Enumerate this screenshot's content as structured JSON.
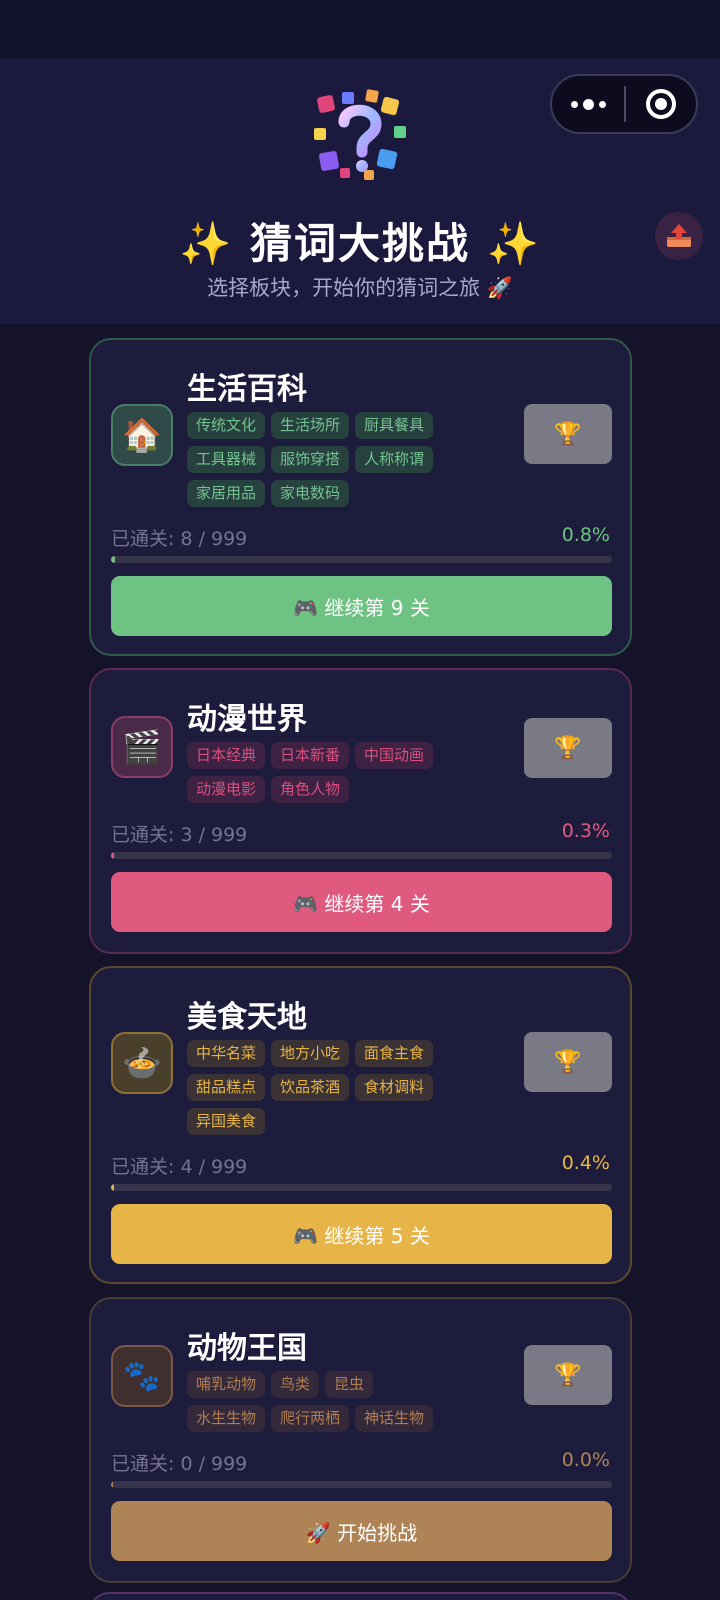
{
  "header": {
    "title": "✨ 猜词大挑战 ✨",
    "subtitle": "选择板块，开始你的猜词之旅 🚀",
    "logo_icon": "question-mark-icon",
    "share_icon": "upload-icon"
  },
  "cards": [
    {
      "name": "生活百科",
      "icon": "🏠",
      "tags": [
        "传统文化",
        "生活场所",
        "厨具餐具",
        "工具器械",
        "服饰穿搭",
        "人称称谓",
        "家居用品",
        "家电数码"
      ],
      "progress_text": "已通关: 8 / 999",
      "percent_text": "0.8%",
      "progress": 0.008,
      "action": "🎮 继续第 9 关",
      "accent": "#6ec383"
    },
    {
      "name": "动漫世界",
      "icon": "🎬",
      "tags": [
        "日本经典",
        "日本新番",
        "中国动画",
        "动漫电影",
        "角色人物"
      ],
      "progress_text": "已通关: 3 / 999",
      "percent_text": "0.3%",
      "progress": 0.003,
      "action": "🎮 继续第 4 关",
      "accent": "#e05a80"
    },
    {
      "name": "美食天地",
      "icon": "🍲",
      "tags": [
        "中华名菜",
        "地方小吃",
        "面食主食",
        "甜品糕点",
        "饮品茶酒",
        "食材调料",
        "异国美食"
      ],
      "progress_text": "已通关: 4 / 999",
      "percent_text": "0.4%",
      "progress": 0.004,
      "action": "🎮 继续第 5 关",
      "accent": "#e7b547"
    },
    {
      "name": "动物王国",
      "icon": "🐾",
      "tags": [
        "哺乳动物",
        "鸟类",
        "昆虫",
        "水生生物",
        "爬行两栖",
        "神话生物"
      ],
      "progress_text": "已通关: 0 / 999",
      "percent_text": "0.0%",
      "progress": 0.0,
      "action": "🚀 开始挑战",
      "accent": "#ae8457"
    }
  ]
}
